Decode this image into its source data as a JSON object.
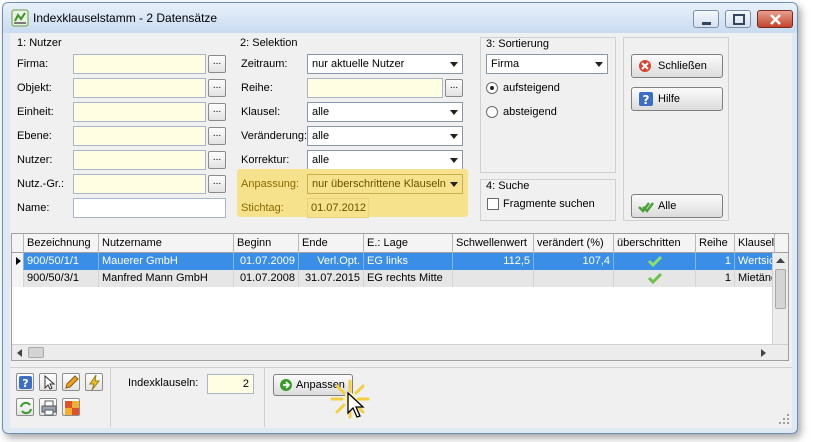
{
  "window": {
    "title": "Indexklauselstamm - 2 Datensätze"
  },
  "nutzer": {
    "title": "1: Nutzer",
    "fields": [
      {
        "label": "Firma:",
        "value": ""
      },
      {
        "label": "Objekt:",
        "value": ""
      },
      {
        "label": "Einheit:",
        "value": ""
      },
      {
        "label": "Ebene:",
        "value": ""
      },
      {
        "label": "Nutzer:",
        "value": ""
      },
      {
        "label": "Nutz.-Gr.:",
        "value": ""
      }
    ],
    "name_label": "Name:",
    "name_value": "",
    "browse_label": "..."
  },
  "selektion": {
    "title": "2: Selektion",
    "zeitraum_label": "Zeitraum:",
    "zeitraum_value": "nur aktuelle Nutzer",
    "reihe_label": "Reihe:",
    "reihe_value": "",
    "klausel_label": "Klausel:",
    "klausel_value": "alle",
    "veraenderung_label": "Veränderung:",
    "veraenderung_value": "alle",
    "korrektur_label": "Korrektur:",
    "korrektur_value": "alle",
    "anpassung_label": "Anpassung:",
    "anpassung_value": "nur überschrittene Klauseln",
    "stichtag_label": "Stichtag:",
    "stichtag_value": "01.07.2012",
    "highlight_color": "#f6e28c"
  },
  "sortierung": {
    "title": "3: Sortierung",
    "field_value": "Firma",
    "asc_label": "aufsteigend",
    "desc_label": "absteigend",
    "selected": "aufsteigend"
  },
  "suche": {
    "title": "4: Suche",
    "fragmente_label": "Fragmente suchen",
    "fragmente_checked": false
  },
  "buttons": {
    "schliessen": "Schließen",
    "hilfe": "Hilfe",
    "alle": "Alle",
    "anpassen": "Anpassen"
  },
  "table": {
    "columns": [
      "Bezeichnung",
      "Nutzername",
      "Beginn",
      "Ende",
      "E.: Lage",
      "Schwellenwert",
      "verändert (%)",
      "überschritten",
      "Reihe",
      "Klausel"
    ],
    "rows": [
      {
        "bezeichnung": "900/50/1/1",
        "nutzername": "Mauerer GmbH",
        "beginn": "01.07.2009",
        "ende": "Verl.Opt.",
        "lage": "EG links",
        "schwellenwert": "112,5",
        "veraendert": "107,4",
        "ueberschritten": true,
        "reihe": "1",
        "klausel": "Wertsic"
      },
      {
        "bezeichnung": "900/50/3/1",
        "nutzername": "Manfred Mann GmbH",
        "beginn": "01.07.2008",
        "ende": "31.07.2015",
        "lage": "EG rechts Mitte",
        "schwellenwert": "",
        "veraendert": "",
        "ueberschritten": true,
        "reihe": "1",
        "klausel": "Mietänc"
      }
    ],
    "selected_row_color": "#3a8ee6",
    "check_color": "#6cc24a"
  },
  "footer": {
    "indexklauseln_label": "Indexklauseln:",
    "indexklauseln_value": "2"
  },
  "icons": {
    "app": "app-logo-icon",
    "help_tool": "help-icon",
    "select_tool": "pointer-icon",
    "edit_tool": "pencil-icon",
    "wizard_tool": "lightning-icon",
    "refresh_tool": "refresh-icon",
    "print_tool": "printer-icon",
    "export_tool": "export-icon"
  }
}
